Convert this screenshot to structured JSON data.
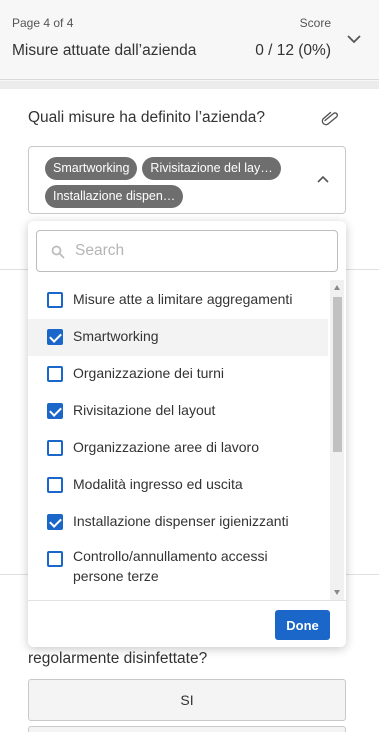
{
  "header": {
    "page_label": "Page 4 of 4",
    "section_title": "Misure attuate dall’azienda",
    "score_label": "Score",
    "score_value": "0 / 12 (0%)"
  },
  "question": {
    "text": "Quali misure ha definito l’azienda?",
    "selected_chips": [
      "Smartworking",
      "Rivisitazione del lay…",
      "Installazione dispen…"
    ]
  },
  "dropdown": {
    "search_placeholder": "Search",
    "options": [
      {
        "label": "Misure atte a limitare aggregamenti",
        "checked": false
      },
      {
        "label": "Smartworking",
        "checked": true
      },
      {
        "label": "Organizzazione dei turni",
        "checked": false
      },
      {
        "label": "Rivisitazione del layout",
        "checked": true
      },
      {
        "label": "Organizzazione aree di lavoro",
        "checked": false
      },
      {
        "label": "Modalità ingresso ed uscita",
        "checked": false
      },
      {
        "label": "Installazione dispenser igienizzanti",
        "checked": true
      },
      {
        "label": "Controllo/annullamento accessi persone terze",
        "checked": false
      }
    ],
    "done_label": "Done"
  },
  "next_question": {
    "text": "regolarmente disinfettate?",
    "yes_label": "SI"
  },
  "colors": {
    "accent": "#1a66c9",
    "chip": "#6e6e6e"
  }
}
